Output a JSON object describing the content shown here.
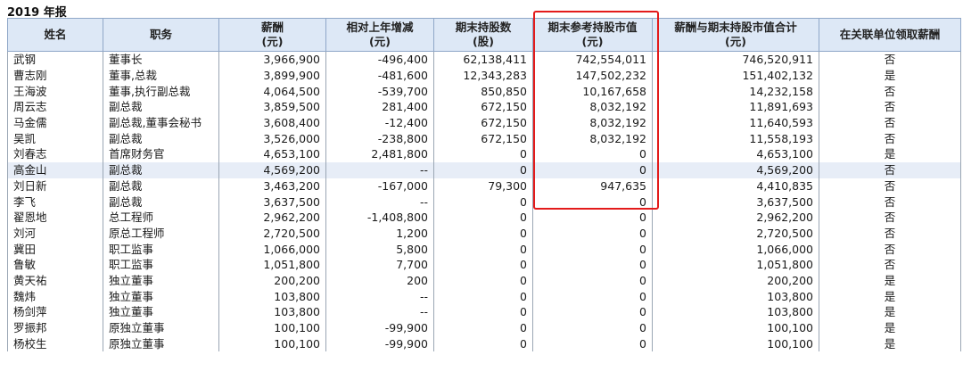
{
  "report_title": "2019 年报",
  "headers": {
    "name": "姓名",
    "position": "职务",
    "salary": [
      "薪酬",
      "(元)"
    ],
    "change": [
      "相对上年增减",
      "(元)"
    ],
    "shares": [
      "期末持股数",
      "(股)"
    ],
    "market_value": [
      "期末参考持股市值",
      "(元)"
    ],
    "total": [
      "薪酬与期末持股市值合计",
      "(元)"
    ],
    "related": "在关联单位领取薪酬"
  },
  "rows": [
    {
      "name": "武钢",
      "position": "董事长",
      "salary": "3,966,900",
      "change": "-496,400",
      "shares": "62,138,411",
      "value": "742,554,011",
      "total": "746,520,911",
      "related": "否"
    },
    {
      "name": "曹志刚",
      "position": "董事,总裁",
      "salary": "3,899,900",
      "change": "-481,600",
      "shares": "12,343,283",
      "value": "147,502,232",
      "total": "151,402,132",
      "related": "是"
    },
    {
      "name": "王海波",
      "position": "董事,执行副总裁",
      "salary": "4,064,500",
      "change": "-539,700",
      "shares": "850,850",
      "value": "10,167,658",
      "total": "14,232,158",
      "related": "否"
    },
    {
      "name": "周云志",
      "position": "副总裁",
      "salary": "3,859,500",
      "change": "281,400",
      "shares": "672,150",
      "value": "8,032,192",
      "total": "11,891,693",
      "related": "否"
    },
    {
      "name": "马金儒",
      "position": "副总裁,董事会秘书",
      "salary": "3,608,400",
      "change": "-12,400",
      "shares": "672,150",
      "value": "8,032,192",
      "total": "11,640,593",
      "related": "否"
    },
    {
      "name": "吴凯",
      "position": "副总裁",
      "salary": "3,526,000",
      "change": "-238,800",
      "shares": "672,150",
      "value": "8,032,192",
      "total": "11,558,193",
      "related": "否"
    },
    {
      "name": "刘春志",
      "position": "首席财务官",
      "salary": "4,653,100",
      "change": "2,481,800",
      "shares": "0",
      "value": "0",
      "total": "4,653,100",
      "related": "是"
    },
    {
      "name": "高金山",
      "position": "副总裁",
      "salary": "4,569,200",
      "change": "--",
      "shares": "0",
      "value": "0",
      "total": "4,569,200",
      "related": "否"
    },
    {
      "name": "刘日新",
      "position": "副总裁",
      "salary": "3,463,200",
      "change": "-167,000",
      "shares": "79,300",
      "value": "947,635",
      "total": "4,410,835",
      "related": "否"
    },
    {
      "name": "李飞",
      "position": "副总裁",
      "salary": "3,637,500",
      "change": "--",
      "shares": "0",
      "value": "0",
      "total": "3,637,500",
      "related": "否"
    },
    {
      "name": "翟恩地",
      "position": "总工程师",
      "salary": "2,962,200",
      "change": "-1,408,800",
      "shares": "0",
      "value": "0",
      "total": "2,962,200",
      "related": "否"
    },
    {
      "name": "刘河",
      "position": "原总工程师",
      "salary": "2,720,500",
      "change": "1,200",
      "shares": "0",
      "value": "0",
      "total": "2,720,500",
      "related": "否"
    },
    {
      "name": "冀田",
      "position": "职工监事",
      "salary": "1,066,000",
      "change": "5,800",
      "shares": "0",
      "value": "0",
      "total": "1,066,000",
      "related": "否"
    },
    {
      "name": "鲁敏",
      "position": "职工监事",
      "salary": "1,051,800",
      "change": "7,700",
      "shares": "0",
      "value": "0",
      "total": "1,051,800",
      "related": "否"
    },
    {
      "name": "黄天祐",
      "position": "独立董事",
      "salary": "200,200",
      "change": "200",
      "shares": "0",
      "value": "0",
      "total": "200,200",
      "related": "是"
    },
    {
      "name": "魏炜",
      "position": "独立董事",
      "salary": "103,800",
      "change": "--",
      "shares": "0",
      "value": "0",
      "total": "103,800",
      "related": "是"
    },
    {
      "name": "杨剑萍",
      "position": "独立董事",
      "salary": "103,800",
      "change": "--",
      "shares": "0",
      "value": "0",
      "total": "103,800",
      "related": "是"
    },
    {
      "name": "罗振邦",
      "position": "原独立董事",
      "salary": "100,100",
      "change": "-99,900",
      "shares": "0",
      "value": "0",
      "total": "100,100",
      "related": "是"
    },
    {
      "name": "杨校生",
      "position": "原独立董事",
      "salary": "100,100",
      "change": "-99,900",
      "shares": "0",
      "value": "0",
      "total": "100,100",
      "related": "是"
    }
  ],
  "highlight_row_index": 7,
  "colors": {
    "header_bg": "#dde8f6",
    "highlight_bg": "#e7edf7",
    "annotation_box": "#e31b1b"
  }
}
